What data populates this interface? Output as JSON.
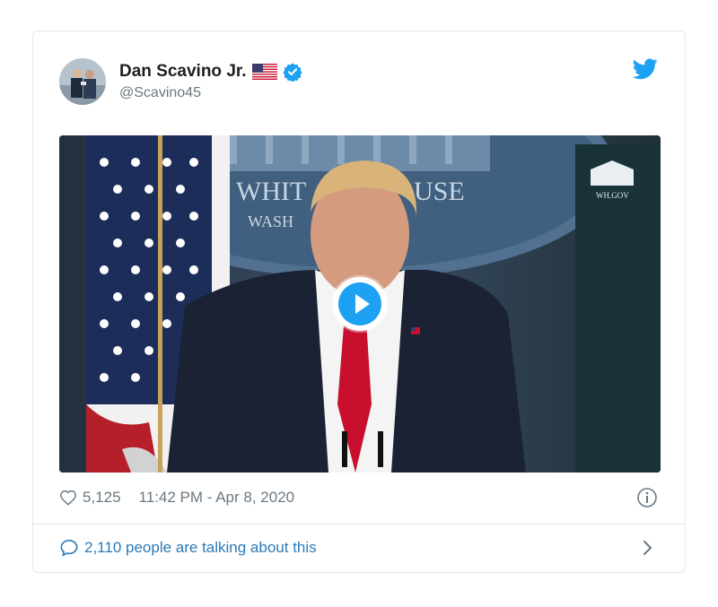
{
  "tweet": {
    "author_name": "Dan Scavino Jr.",
    "handle": "@Scavino45",
    "likes": "5,125",
    "timestamp": "11:42 PM - Apr 8, 2020",
    "talking": "2,110 people are talking about this"
  },
  "media": {
    "seal_text_1": "HE WHIT",
    "seal_text_2": "USE",
    "seal_text_3": "WASH",
    "wh_gov": "WH.GOV"
  },
  "icons": {
    "flag": "us-flag-icon",
    "verified": "verified-badge-icon",
    "bird": "twitter-bird-icon",
    "heart": "heart-icon",
    "info": "info-icon",
    "bubble": "comment-bubble-icon",
    "chevron": "chevron-right-icon",
    "play": "play-icon"
  },
  "colors": {
    "twitter_blue": "#1da1f2",
    "link_blue": "#2b7bb9",
    "muted_gray": "#697882",
    "verified_blue": "#1da1f2",
    "tie_red": "#c8102e"
  }
}
